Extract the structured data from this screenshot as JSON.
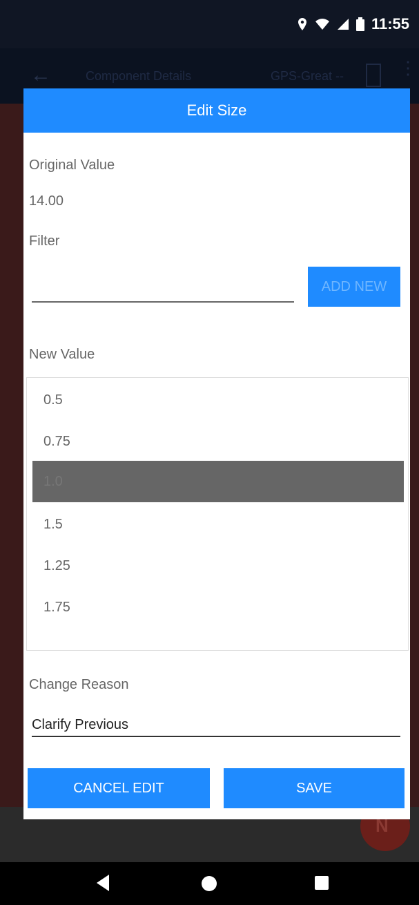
{
  "status_bar": {
    "time": "11:55",
    "icons": [
      "location-icon",
      "wifi-icon",
      "signal-icon",
      "battery-icon"
    ]
  },
  "app_bar": {
    "title": "Component Details",
    "gps_status": "GPS-Great --"
  },
  "dialog": {
    "title": "Edit Size",
    "original_value_label": "Original Value",
    "original_value": "14.00",
    "filter_label": "Filter",
    "filter_value": "",
    "add_new_label": "ADD NEW",
    "new_value_label": "New Value",
    "values": [
      "0.5",
      "0.75",
      "1.0",
      "1.5",
      "1.25",
      "1.75"
    ],
    "selected_value": "1.0",
    "change_reason_label": "Change Reason",
    "change_reason_value": "Clarify Previous",
    "cancel_label": "CANCEL EDIT",
    "save_label": "SAVE"
  },
  "colors": {
    "accent": "#1f8bff",
    "selected_row": "#666666"
  }
}
